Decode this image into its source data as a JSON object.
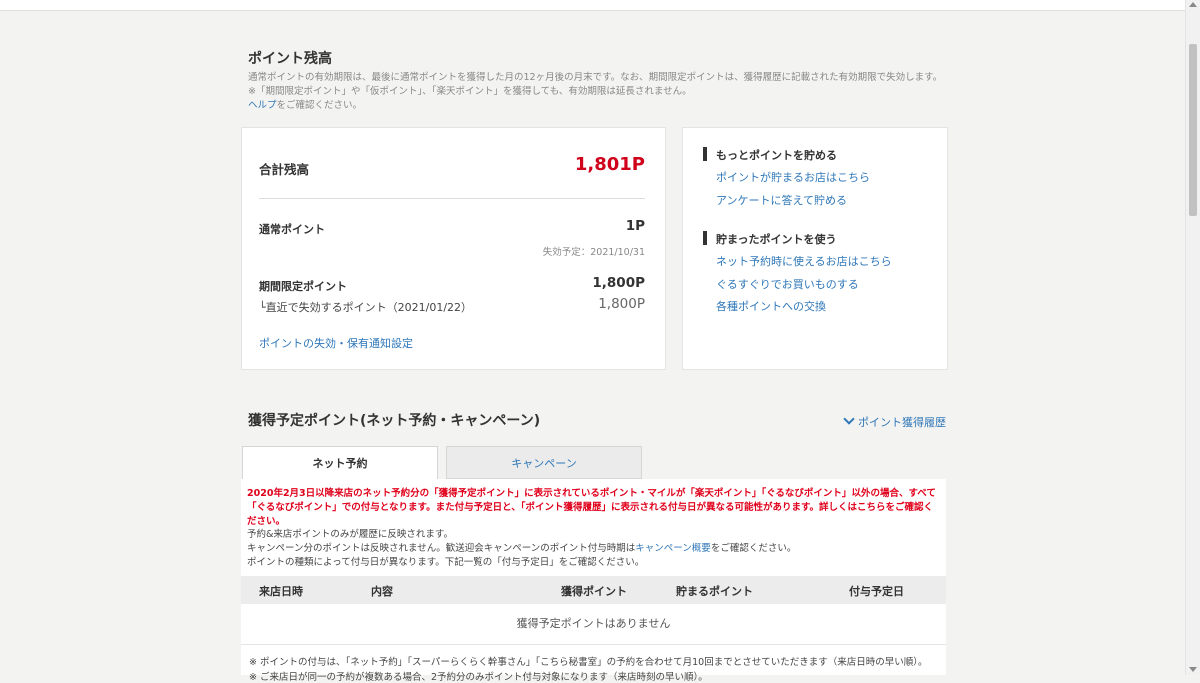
{
  "balance": {
    "title": "ポイント残高",
    "note1": "通常ポイントの有効期限は、最後に通常ポイントを獲得した月の12ヶ月後の月末です。なお、期間限定ポイントは、獲得履歴に記載された有効期限で失効します。",
    "note2": "※「期間限定ポイント」や「仮ポイント」、「楽天ポイント」を獲得しても、有効期限は延長されません。",
    "help_link": "ヘルプ",
    "help_suffix": "をご確認ください。",
    "total_label": "合計残高",
    "total_value": "1,801P",
    "normal_label": "通常ポイント",
    "normal_value": "1P",
    "normal_expiry": "失効予定：2021/10/31",
    "limited_label": "期間限定ポイント",
    "limited_value": "1,800P",
    "nearest_label": "└直近で失効するポイント（2021/01/22）",
    "nearest_value": "1,800P",
    "notify_link": "ポイントの失効・保有通知設定"
  },
  "right": {
    "earn_head": "もっとポイントを貯める",
    "earn_links": [
      "ポイントが貯まるお店はこちら",
      "アンケートに答えて貯める"
    ],
    "use_head": "貯まったポイントを使う",
    "use_links": [
      "ネット予約時に使えるお店はこちら",
      "ぐるすぐりでお買いものする",
      "各種ポイントへの交換"
    ]
  },
  "planned": {
    "title": "獲得予定ポイント(ネット予約・キャンペーン)",
    "history_link": "ポイント獲得履歴",
    "tabs": [
      "ネット予約",
      "キャンペーン"
    ],
    "red_note": "2020年2月3日以降来店のネット予約分の「獲得予定ポイント」に表示されているポイント・マイルが「楽天ポイント」「ぐるなびポイント」以外の場合、すべて「ぐるなびポイント」での付与となります。また付与予定日と、「ポイント獲得履歴」に表示される付与日が異なる可能性があります。詳しくはこちらをご確認ください。",
    "info1": "予約&来店ポイントのみが履歴に反映されます。",
    "info2_a": "キャンペーン分のポイントは反映されません。歓送迎会キャンペーンのポイント付与時期は",
    "info2_link": "キャンペーン概要",
    "info2_b": "をご確認ください。",
    "info3": "ポイントの種類によって付与日が異なります。下記一覧の「付与予定日」をご確認ください。",
    "columns": [
      "来店日時",
      "内容",
      "獲得ポイント",
      "貯まるポイント",
      "付与予定日"
    ],
    "empty": "獲得予定ポイントはありません",
    "foot1": "※ ポイントの付与は、「ネット予約」「スーパーらくらく幹事さん」「こちら秘書室」の予約を合わせて月10回までとさせていただきます（来店日時の早い順）。",
    "foot2": "※ ご来店日が同一の予約が複数ある場合、2予約分のみポイント付与対象になります（来店時刻の早い順）。"
  }
}
